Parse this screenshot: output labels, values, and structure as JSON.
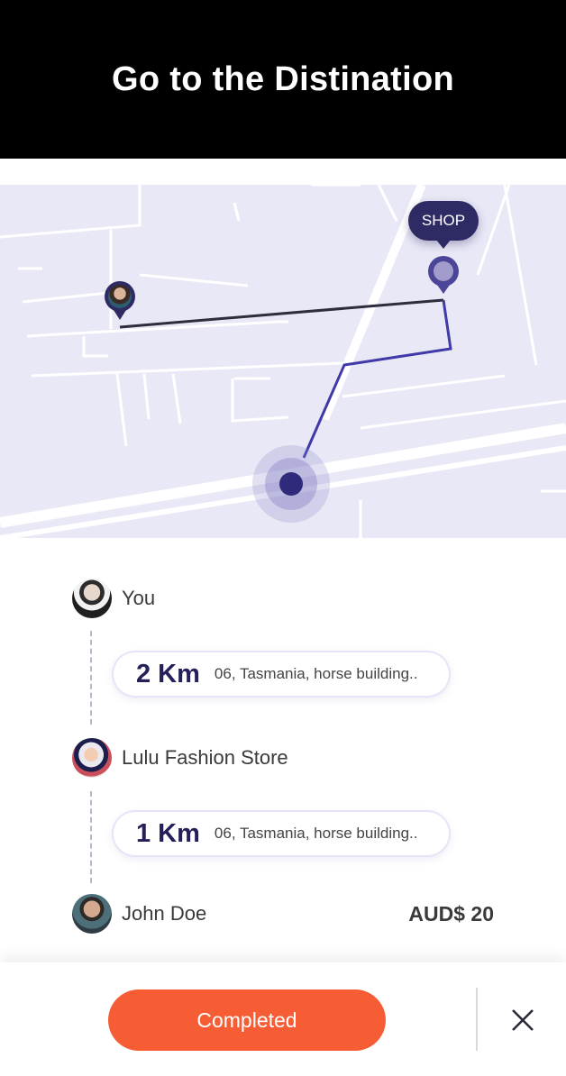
{
  "header": {
    "title": "Go to the Distination"
  },
  "map": {
    "shop_label": "SHOP",
    "route_color": "#3f3aa8",
    "background_color": "#e9e8f6"
  },
  "timeline": {
    "you_label": "You",
    "leg1": {
      "distance": "2 Km",
      "address": "06, Tasmania, horse building.."
    },
    "store_label": "Lulu Fashion Store",
    "leg2": {
      "distance": "1 Km",
      "address": "06, Tasmania, horse building.."
    },
    "driver_label": "John Doe",
    "price": "AUD$ 20"
  },
  "actions": {
    "complete_label": "Completed",
    "complete_color": "#f65d34",
    "close_icon": "close-icon"
  }
}
